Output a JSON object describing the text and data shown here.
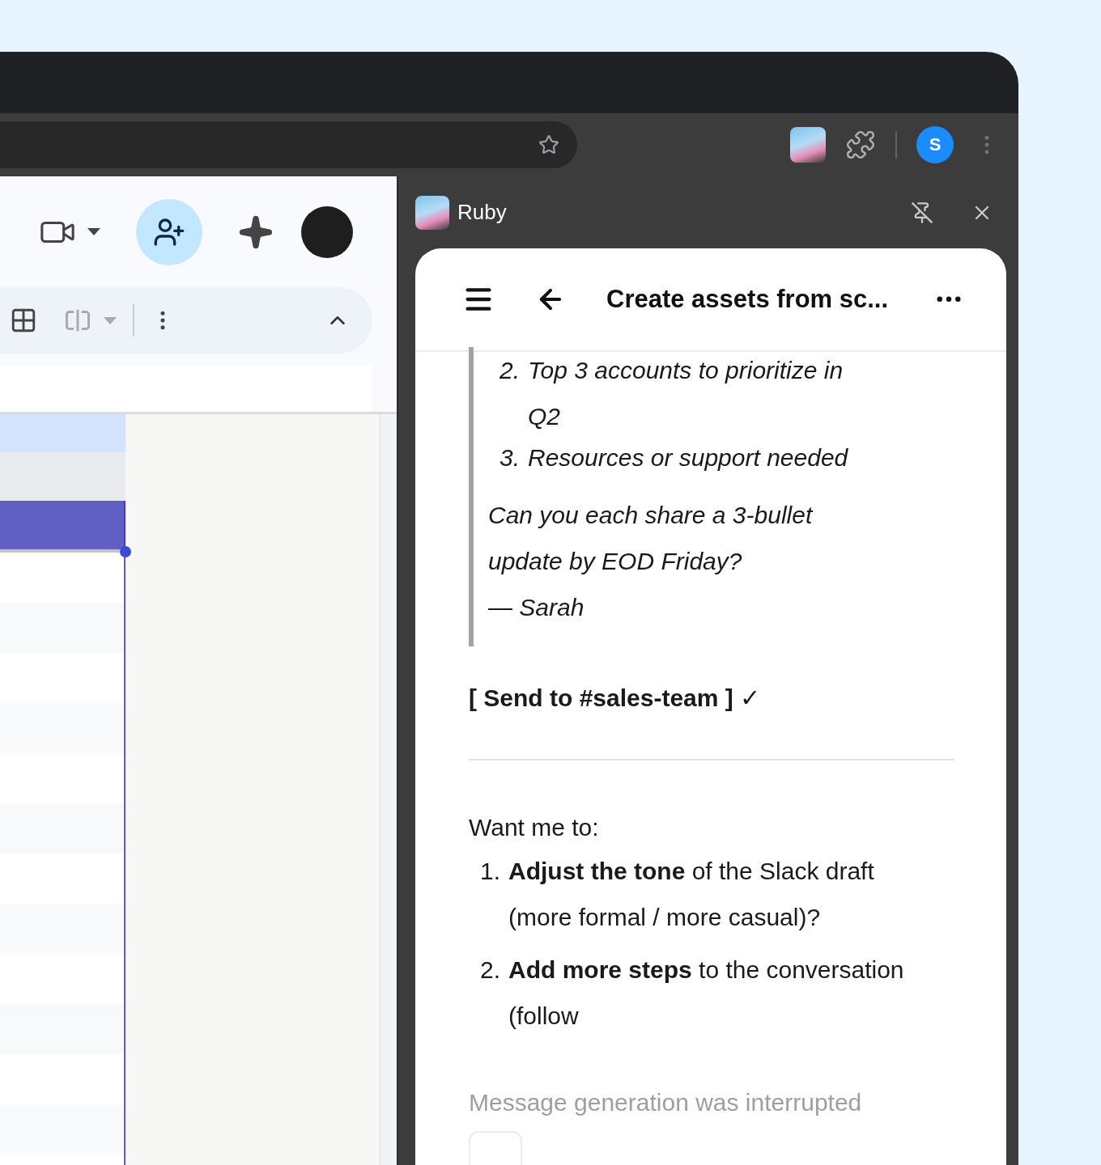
{
  "browser": {
    "profile_initial": "S"
  },
  "side_panel": {
    "title": "Ruby"
  },
  "chat": {
    "title": "Create assets from sc...",
    "quote": {
      "list_items": [
        {
          "number": "2.",
          "text": "Top 3 accounts to prioritize in Q2"
        },
        {
          "number": "3.",
          "text": "Resources or support needed"
        }
      ],
      "lines": [
        "Can you each share a 3-bullet",
        "update by EOD Friday?",
        "— Sarah"
      ]
    },
    "action": "[ Send to #sales-team ] ✓",
    "intro": "Want me to:",
    "options": [
      {
        "number": "1.",
        "text": "**Adjust the tone** of the Slack draft (more formal / more casual)?"
      },
      {
        "number": "2.",
        "text": "**Add more steps** to the conversation (follow"
      }
    ],
    "status": "Message generation was interrupted"
  }
}
